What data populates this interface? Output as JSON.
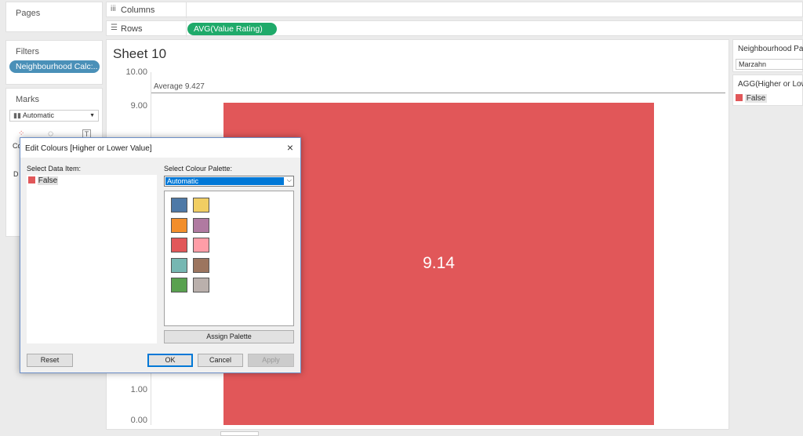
{
  "panels": {
    "pages_title": "Pages",
    "filters_title": "Filters",
    "marks_title": "Marks",
    "columns_label": "Columns",
    "rows_label": "Rows"
  },
  "filters": {
    "pill": "Neighbourhood Calc:.."
  },
  "marks": {
    "type_value": "Automatic",
    "cards": [
      "Co",
      "D"
    ]
  },
  "rows": {
    "pill": "AVG(Value Rating)"
  },
  "sheet": {
    "title": "Sheet 10",
    "reference_line": "Average 9.427",
    "bar_label": "9.14"
  },
  "chart_data": {
    "type": "bar",
    "categories": [
      "False"
    ],
    "values": [
      9.14
    ],
    "title": "Sheet 10",
    "ylim": [
      0,
      10
    ],
    "y_ticks": [
      "10.00",
      "9.00",
      "1.00",
      "0.00"
    ],
    "reference_line": {
      "label": "Average 9.427",
      "value": 9.427
    },
    "bar_color": "#e15759"
  },
  "right_panel": {
    "neighbourhood_title": "Neighbourhood Pa",
    "neighbourhood_value": "Marzahn",
    "legend_title": "AGG(Higher or Low",
    "legend_item": "False"
  },
  "dialog": {
    "title": "Edit Colours [Higher or Lower Value]",
    "close_icon": "×",
    "select_data_item_label": "Select Data Item:",
    "data_item": "False",
    "select_palette_label": "Select Colour Palette:",
    "palette_value": "Automatic",
    "assign_palette": "Assign Palette",
    "reset": "Reset",
    "ok": "OK",
    "cancel": "Cancel",
    "apply": "Apply",
    "palette_colors": [
      "#4e79a7",
      "#f1ce63",
      "#f28e2b",
      "#b07aa1",
      "#e15759",
      "#ff9da7",
      "#76b7b2",
      "#9c755f",
      "#59a14f",
      "#bab0ac"
    ]
  },
  "colors": {
    "accent_green": "#1faa6a",
    "accent_blue": "#4a90b8",
    "bar_red": "#e15759",
    "select_blue": "#0078d7"
  }
}
